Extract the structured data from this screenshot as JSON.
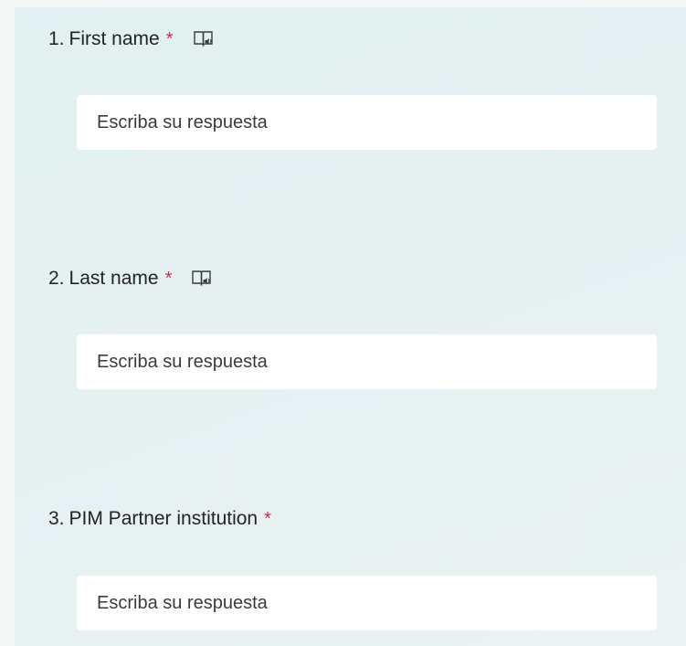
{
  "questions": [
    {
      "number": "1.",
      "label": "First name",
      "required_mark": "*",
      "reader_icon": "immersive-reader-icon",
      "placeholder": "Escriba su respuesta"
    },
    {
      "number": "2.",
      "label": "Last name",
      "required_mark": "*",
      "reader_icon": "immersive-reader-icon",
      "placeholder": "Escriba su respuesta"
    },
    {
      "number": "3.",
      "label": "PIM Partner institution",
      "required_mark": "*",
      "placeholder": "Escriba su respuesta"
    }
  ],
  "colors": {
    "required": "#c4314b",
    "panel_background": "#e4f0f0",
    "input_background": "#ffffff"
  }
}
